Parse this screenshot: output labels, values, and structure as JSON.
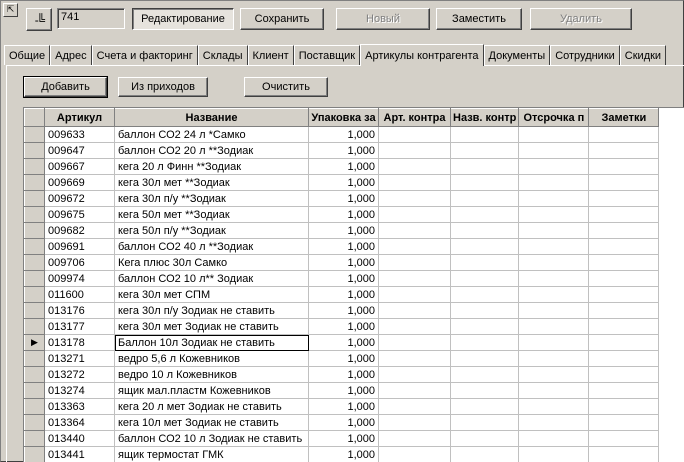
{
  "toolbar": {
    "id_value": "741",
    "edit_label": "Редактирование",
    "save_label": "Сохранить",
    "new_label": "Новый",
    "replace_label": "Заместить",
    "delete_label": "Удалить"
  },
  "tabs": [
    "Общие",
    "Адрес",
    "Счета и факторинг",
    "Склады",
    "Клиент",
    "Поставщик",
    "Артикулы контрагента",
    "Документы",
    "Сотрудники",
    "Скидки"
  ],
  "active_tab_index": 6,
  "actions": {
    "add_label": "Добавить",
    "from_receipts_label": "Из приходов",
    "clear_label": "Очистить"
  },
  "grid": {
    "columns": [
      "Артикул",
      "Название",
      "Упаковка за",
      "Арт. контра",
      "Назв. контр",
      "Отсрочка п",
      "Заметки"
    ],
    "current_row_index": 13,
    "rows": [
      {
        "code": "009633",
        "name": "баллон СО2 24 л  *Самко",
        "pack": "1,000"
      },
      {
        "code": "009647",
        "name": "баллон СО2 20 л  **Зодиак",
        "pack": "1,000"
      },
      {
        "code": "009667",
        "name": "кега 20 л Финн **Зодиак",
        "pack": "1,000"
      },
      {
        "code": "009669",
        "name": "кега 30л мет **Зодиак",
        "pack": "1,000"
      },
      {
        "code": "009672",
        "name": "кега 30л п/у **Зодиак",
        "pack": "1,000"
      },
      {
        "code": "009675",
        "name": "кега 50л мет **Зодиак",
        "pack": "1,000"
      },
      {
        "code": "009682",
        "name": "кега 50л п/у **Зодиак",
        "pack": "1,000"
      },
      {
        "code": "009691",
        "name": "баллон СО2 40 л  **Зодиак",
        "pack": "1,000"
      },
      {
        "code": "009706",
        "name": "Кега плюс 30л Самко",
        "pack": "1,000"
      },
      {
        "code": "009974",
        "name": "баллон СО2 10 л** Зодиак",
        "pack": "1,000"
      },
      {
        "code": "011600",
        "name": "кега 30л мет СПМ",
        "pack": "1,000"
      },
      {
        "code": "013176",
        "name": "кега 30л п/у Зодиак не ставить",
        "pack": "1,000"
      },
      {
        "code": "013177",
        "name": "кега 30л мет Зодиак не ставить",
        "pack": "1,000"
      },
      {
        "code": "013178",
        "name": "Баллон 10л Зодиак не ставить",
        "pack": "1,000"
      },
      {
        "code": "013271",
        "name": "ведро 5,6 л  Кожевников",
        "pack": "1,000"
      },
      {
        "code": "013272",
        "name": "ведро 10 л  Кожевников",
        "pack": "1,000"
      },
      {
        "code": "013274",
        "name": "ящик мал.пластм  Кожевников",
        "pack": "1,000"
      },
      {
        "code": "013363",
        "name": "кега 20 л мет Зодиак не ставить",
        "pack": "1,000"
      },
      {
        "code": "013364",
        "name": "кега 10л мет Зодиак не ставить",
        "pack": "1,000"
      },
      {
        "code": "013440",
        "name": "баллон СО2 10 л  Зодиак не ставить",
        "pack": "1,000"
      },
      {
        "code": "013441",
        "name": "ящик термостат ГМК",
        "pack": "1,000"
      }
    ]
  }
}
